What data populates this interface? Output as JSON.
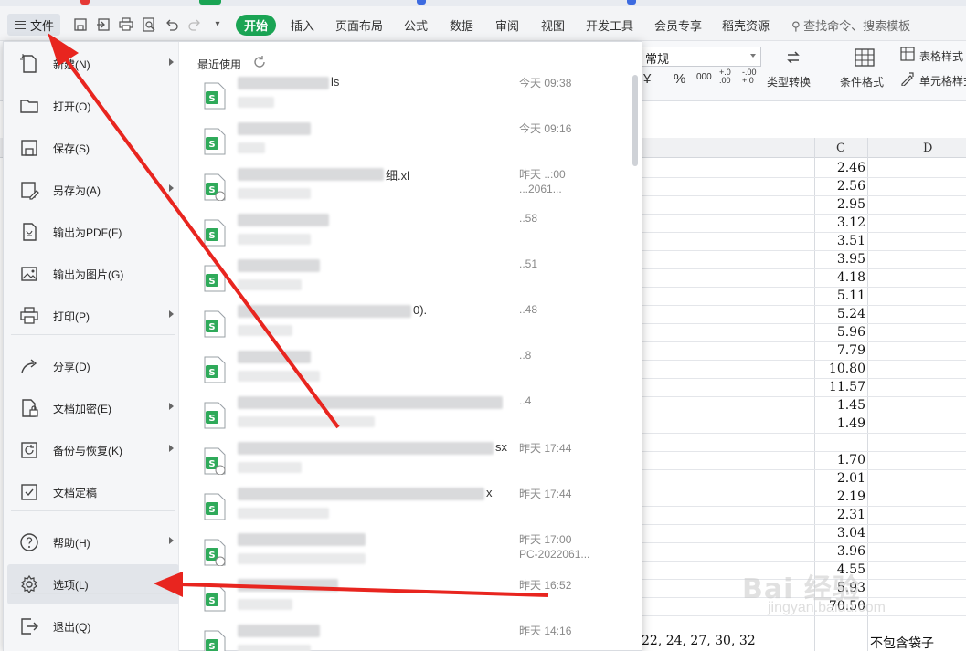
{
  "ribbon_tabs": {
    "file": "文件",
    "tabs": [
      "开始",
      "插入",
      "页面布局",
      "公式",
      "数据",
      "审阅",
      "视图",
      "开发工具",
      "会员专享",
      "稻壳资源"
    ],
    "search_placeholder": "查找命令、搜索模板"
  },
  "ribbon": {
    "number_format": "常规",
    "type_convert": "类型转换",
    "cond_format": "条件格式",
    "table_style": "表格样式",
    "cell_style": "单元格样式",
    "currency": "¥",
    "percent": "%",
    "thousands": "000",
    "dec_inc": "+.0 .00",
    "dec_dec": "-.00 +.0"
  },
  "file_menu": {
    "items": [
      {
        "label": "新建(N)",
        "icon": "new-file-icon",
        "has_submenu": true
      },
      {
        "label": "打开(O)",
        "icon": "folder-icon",
        "has_submenu": false
      },
      {
        "label": "保存(S)",
        "icon": "save-icon",
        "has_submenu": false
      },
      {
        "label": "另存为(A)",
        "icon": "save-as-icon",
        "has_submenu": true
      },
      {
        "label": "输出为PDF(F)",
        "icon": "pdf-icon",
        "has_submenu": false
      },
      {
        "label": "输出为图片(G)",
        "icon": "image-icon",
        "has_submenu": false
      },
      {
        "label": "打印(P)",
        "icon": "printer-icon",
        "has_submenu": true
      },
      {
        "label": "分享(D)",
        "icon": "share-icon",
        "has_submenu": false
      },
      {
        "label": "文档加密(E)",
        "icon": "lock-doc-icon",
        "has_submenu": true
      },
      {
        "label": "备份与恢复(K)",
        "icon": "backup-icon",
        "has_submenu": true
      },
      {
        "label": "文档定稿",
        "icon": "finalize-icon",
        "has_submenu": false
      },
      {
        "label": "帮助(H)",
        "icon": "help-icon",
        "has_submenu": true
      },
      {
        "label": "选项(L)",
        "icon": "gear-icon",
        "has_submenu": false
      },
      {
        "label": "退出(Q)",
        "icon": "exit-icon",
        "has_submenu": false
      }
    ]
  },
  "recent": {
    "title": "最近使用",
    "files": [
      {
        "name_tail": "ls",
        "time": "今天 09:38",
        "sub": "",
        "cloud": false
      },
      {
        "name_tail": "",
        "time": "今天 09:16",
        "sub": "",
        "cloud": false
      },
      {
        "name_tail": "细.xl",
        "time": "昨天 ..:00",
        "sub": "...2061...",
        "cloud": true
      },
      {
        "name_tail": "",
        "time": "..58",
        "sub": "",
        "cloud": false
      },
      {
        "name_tail": "",
        "time": "..51",
        "sub": "",
        "cloud": false
      },
      {
        "name_tail": "0).",
        "time": "..48",
        "sub": "",
        "cloud": false
      },
      {
        "name_tail": "",
        "time": "..8",
        "sub": "",
        "cloud": false
      },
      {
        "name_tail": "",
        "time": "..4",
        "sub": "",
        "cloud": false
      },
      {
        "name_tail": "sx",
        "time": "昨天 17:44",
        "sub": "",
        "cloud": true
      },
      {
        "name_tail": "x",
        "time": "昨天 17:44",
        "sub": "",
        "cloud": false
      },
      {
        "name_tail": "",
        "time": "昨天 17:00",
        "sub": "PC-2022061...",
        "cloud": true
      },
      {
        "name_tail": "",
        "time": "昨天 16:52",
        "sub": "",
        "cloud": false
      },
      {
        "name_tail": "",
        "time": "昨天 14:16",
        "sub": "",
        "cloud": false
      }
    ]
  },
  "sheet": {
    "col_c": "C",
    "col_d": "D",
    "c_values": [
      "2.46",
      "2.56",
      "2.95",
      "3.12",
      "3.51",
      "3.95",
      "4.18",
      "5.11",
      "5.24",
      "5.96",
      "7.79",
      "10.80",
      "11.57",
      "1.45",
      "1.49",
      "",
      "1.70",
      "2.01",
      "2.19",
      "2.31",
      "3.04",
      "3.96",
      "4.55",
      "5.93",
      "70.50"
    ],
    "bottom_left_text": "22, 24, 27, 30, 32",
    "bottom_right_text": "不包含袋子"
  },
  "watermark": {
    "main": "Bai 经验",
    "sub": "jingyan.baidu.com"
  }
}
